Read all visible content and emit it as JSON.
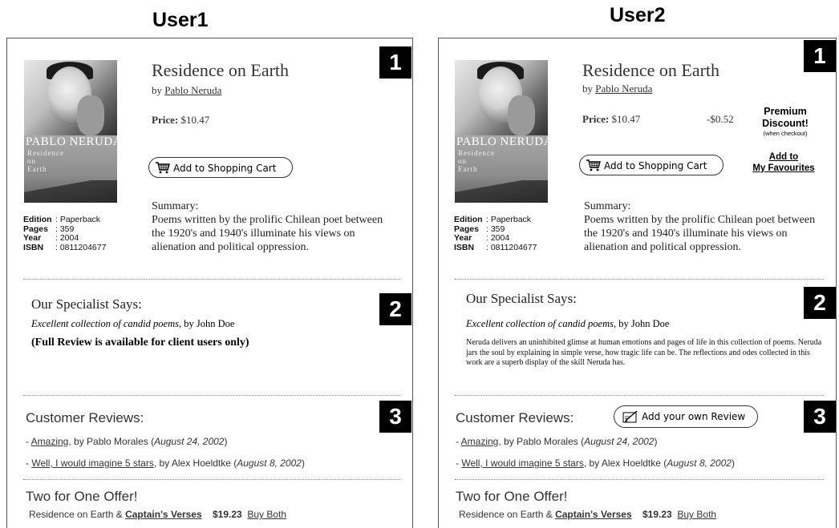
{
  "headings": {
    "user1": "User1",
    "user2": "User2"
  },
  "book": {
    "cover_author": "PABLO NERUDA",
    "cover_title_lines": [
      "Residence",
      "on",
      "Earth"
    ],
    "title": "Residence on Earth",
    "by": "by",
    "author": "Pablo Neruda",
    "price_label": "Price:",
    "price": "$10.47",
    "cart_button": "Add to Shopping Cart",
    "summary_label": "Summary:",
    "summary": "Poems written by the prolific Chilean poet between the 1920's and 1940's illuminate his views on alienation and political oppression.",
    "specs": [
      {
        "label": "Edition",
        "value": ": Paperback"
      },
      {
        "label": "Pages",
        "value": ": 359"
      },
      {
        "label": "Year",
        "value": ": 2004"
      },
      {
        "label": "ISBN",
        "value": ": 0811204677"
      }
    ]
  },
  "section_numbers": [
    "1",
    "2",
    "3"
  ],
  "specialist": {
    "heading": "Our Specialist Says:",
    "review_title": "Excellent collection of candid poems",
    "review_by": ", by John Doe",
    "restricted_note": "(Full Review is available for client users only)",
    "full_text": "Neruda delivers an uninhibited glimse at human emotions and pages of life in this collection of poems. Neruda jars the soul by explaining in simple verse, how tragic life can be. The reflections and odes collected in this work are a superb display of the skill Neruda has."
  },
  "customer_reviews": {
    "heading": "Customer Reviews:",
    "add_review_button": "Add your own Review",
    "items": [
      {
        "prefix": "- ",
        "title": "Amazing",
        "by": ", by Pablo Morales (",
        "date": "August 24, 2002",
        "suffix": ")"
      },
      {
        "prefix": "- ",
        "title": "Well, I would imagine 5 stars",
        "by": ", by Alex Hoeldtke (",
        "date": "August 8, 2002",
        "suffix": ")"
      }
    ]
  },
  "offer": {
    "heading": "Two for One Offer!",
    "text": "Residence on Earth & ",
    "other_book": "Captain's Verses",
    "price": "$19.23",
    "buy_link": "Buy Both"
  },
  "premium": {
    "discount": "-$0.52",
    "line1": "Premium",
    "line2": "Discount!",
    "note": "(when checkout)",
    "fav_line1": "Add to",
    "fav_line2": "My Favourites"
  }
}
